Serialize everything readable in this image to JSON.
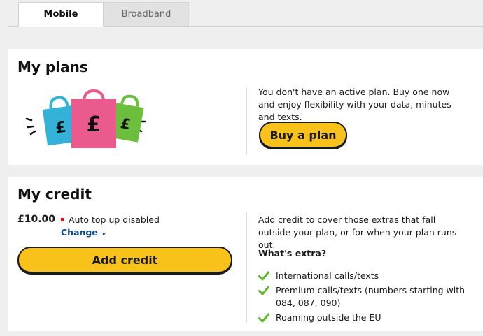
{
  "tabs": [
    {
      "label": "Mobile",
      "active": true
    },
    {
      "label": "Broadband",
      "active": false
    }
  ],
  "plans": {
    "title": "My plans",
    "illustration": "shopping-bags-pound-icon",
    "description": "You don't have an active plan. Buy one now and enjoy flexibility with your data, minutes and texts.",
    "buy_label": "Buy a plan"
  },
  "credit": {
    "title": "My credit",
    "balance": "£10.00",
    "topup_status": "Auto top up disabled",
    "change_label": "Change",
    "add_label": "Add credit",
    "description": "Add credit to cover those extras that fall outside your plan, or for when your plan runs out.",
    "extras_heading": "What's extra?",
    "extras": [
      "International calls/texts",
      "Premium calls/texts (numbers starting with 084, 087, 090)",
      "Roaming outside the EU"
    ]
  },
  "colors": {
    "accent_yellow": "#f9c21a",
    "link_blue": "#0c4a8c",
    "check_green": "#5cb82c",
    "status_red": "#e1141c"
  }
}
